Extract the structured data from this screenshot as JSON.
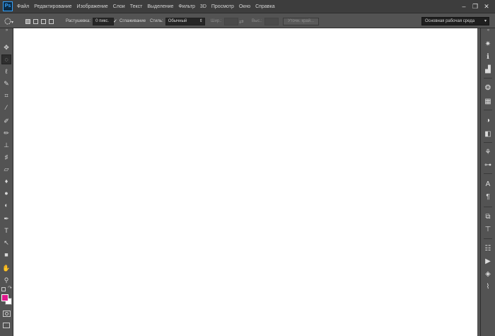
{
  "app": {
    "logo_text": "Ps"
  },
  "menubar": {
    "items": [
      "Файл",
      "Редактирование",
      "Изображение",
      "Слои",
      "Текст",
      "Выделение",
      "Фильтр",
      "3D",
      "Просмотр",
      "Окно",
      "Справка"
    ]
  },
  "window_controls": {
    "minimize": "–",
    "restore": "❐",
    "close": "✕"
  },
  "options_bar": {
    "feather_label": "Растушевка:",
    "feather_value": "0 пикс.",
    "antialias_label": "Сглаживание",
    "antialias_checked": true,
    "style_label": "Стиль:",
    "style_value": "Обычный",
    "width_label": "Шир.:",
    "height_label": "Выс.:",
    "refine_button": "Уточн. край...",
    "workspace_value": "Основная рабочая среда"
  },
  "left_tools": [
    {
      "name": "move-tool",
      "glyph": "✥"
    },
    {
      "name": "marquee-tool",
      "glyph": "◌"
    },
    {
      "name": "lasso-tool",
      "glyph": "ℓ"
    },
    {
      "name": "quick-select-tool",
      "glyph": "✎"
    },
    {
      "name": "crop-tool",
      "glyph": "⌗"
    },
    {
      "name": "eyedropper-tool",
      "glyph": "⁄"
    },
    {
      "name": "healing-brush-tool",
      "glyph": "✐"
    },
    {
      "name": "brush-tool",
      "glyph": "✏"
    },
    {
      "name": "clone-stamp-tool",
      "glyph": "⊥"
    },
    {
      "name": "history-brush-tool",
      "glyph": "♯"
    },
    {
      "name": "eraser-tool",
      "glyph": "▱"
    },
    {
      "name": "paint-bucket-tool",
      "glyph": "♦"
    },
    {
      "name": "blur-tool",
      "glyph": "●"
    },
    {
      "name": "dodge-tool",
      "glyph": "◐"
    },
    {
      "name": "pen-tool",
      "glyph": "✒"
    },
    {
      "name": "type-tool",
      "glyph": "T"
    },
    {
      "name": "path-select-tool",
      "glyph": "↖"
    },
    {
      "name": "rectangle-tool",
      "glyph": "■"
    },
    {
      "name": "hand-tool",
      "glyph": "✋"
    },
    {
      "name": "zoom-tool",
      "glyph": "⚲"
    }
  ],
  "right_panels": [
    {
      "name": "navigator-icon",
      "glyph": "✷"
    },
    {
      "name": "info-icon",
      "glyph": "ℹ"
    },
    {
      "name": "histogram-icon",
      "glyph": "▟"
    },
    {
      "name": "color-icon",
      "glyph": "❂"
    },
    {
      "name": "swatches-icon",
      "glyph": "▦"
    },
    {
      "name": "adjustments-icon",
      "glyph": "◑"
    },
    {
      "name": "styles-icon",
      "glyph": "◧"
    },
    {
      "name": "brush-presets-icon",
      "glyph": "⚘"
    },
    {
      "name": "tool-presets-icon",
      "glyph": "⊶"
    },
    {
      "name": "character-icon",
      "glyph": "A"
    },
    {
      "name": "paragraph-icon",
      "glyph": "¶"
    },
    {
      "name": "clone-source-icon",
      "glyph": "⧉"
    },
    {
      "name": "3d-icon",
      "glyph": "⊤"
    },
    {
      "name": "properties-icon",
      "glyph": "☷"
    },
    {
      "name": "actions-icon",
      "glyph": "▶"
    },
    {
      "name": "layers-icon",
      "glyph": "◈"
    },
    {
      "name": "paths-icon",
      "glyph": "⌇"
    }
  ],
  "colors": {
    "foreground": "#e0198d",
    "background": "#ffffff",
    "canvas": "#ffffff"
  }
}
